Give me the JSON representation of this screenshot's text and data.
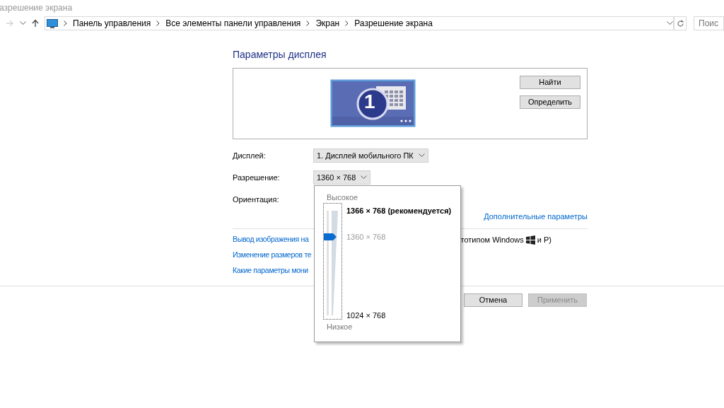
{
  "window": {
    "title": "азрешение экрана"
  },
  "address_bar": {
    "breadcrumbs": [
      "Панель управления",
      "Все элементы панели управления",
      "Экран",
      "Разрешение экрана"
    ],
    "search_placeholder": "Поис"
  },
  "heading": "Параметры дисплея",
  "monitor_preview": {
    "number": "1"
  },
  "preview_buttons": [
    "Найти",
    "Определить"
  ],
  "fields": [
    {
      "label": "Дисплей:",
      "value": "1. Дисплей мобильного ПК"
    },
    {
      "label": "Разрешение:",
      "value": "1360 × 768"
    },
    {
      "label": "Ориентация:"
    }
  ],
  "advanced_link": "Дополнительные параметры",
  "links": [
    {
      "left": "Вывод изображения на",
      "right": "тотипом Windows",
      "suffix": "и P)"
    },
    {
      "left": "Изменение размеров те"
    },
    {
      "left": "Какие параметры мони"
    }
  ],
  "buttons": [
    {
      "label": "Отмена",
      "disabled": false
    },
    {
      "label": "Применить",
      "disabled": true
    }
  ],
  "resolution_popup": {
    "high_label": "Высокое",
    "low_label": "Низкое",
    "level": 0.75,
    "items": [
      {
        "label": "1366 × 768 (рекомендуется)",
        "kind": "recommended"
      },
      {
        "label": "1360 × 768",
        "kind": "current"
      },
      {
        "label": "1024 × 768",
        "kind": "normal"
      }
    ]
  }
}
